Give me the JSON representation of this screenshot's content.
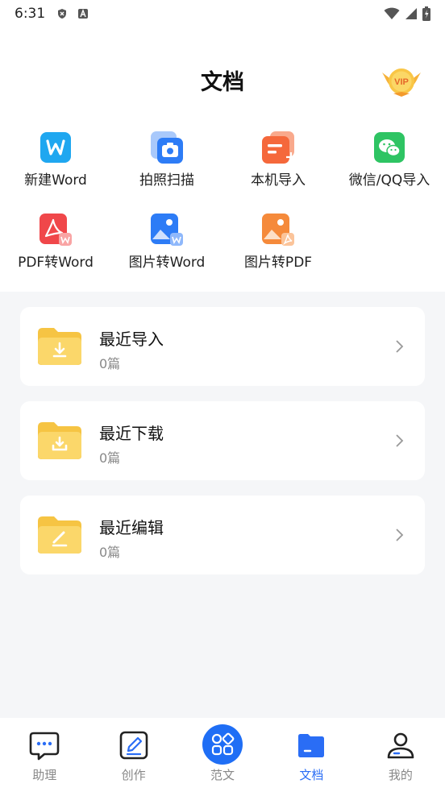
{
  "status_bar": {
    "time": "6:31"
  },
  "page": {
    "title": "文档"
  },
  "vip": {
    "label": "VIP"
  },
  "tools": [
    {
      "label": "新建Word",
      "icon": "word-icon",
      "color": "#1fa7f0"
    },
    {
      "label": "拍照扫描",
      "icon": "camera-scan-icon",
      "color": "#2d7cf6"
    },
    {
      "label": "本机导入",
      "icon": "local-import-icon",
      "color": "#f5683b"
    },
    {
      "label": "微信/QQ导入",
      "icon": "wechat-icon",
      "color": "#2ec463"
    },
    {
      "label": "PDF转Word",
      "icon": "pdf-to-word-icon",
      "color": "#f0474a"
    },
    {
      "label": "图片转Word",
      "icon": "image-to-word-icon",
      "color": "#2d7cf6"
    },
    {
      "label": "图片转PDF",
      "icon": "image-to-pdf-icon",
      "color": "#f58a3b"
    }
  ],
  "folders": [
    {
      "title": "最近导入",
      "count": "0篇",
      "icon": "folder-import-icon"
    },
    {
      "title": "最近下载",
      "count": "0篇",
      "icon": "folder-download-icon"
    },
    {
      "title": "最近编辑",
      "count": "0篇",
      "icon": "folder-edit-icon"
    }
  ],
  "nav": [
    {
      "label": "助理",
      "icon": "chat-bubble-icon",
      "active": false
    },
    {
      "label": "创作",
      "icon": "pen-edit-icon",
      "active": false
    },
    {
      "label": "范文",
      "icon": "grid-apps-icon",
      "active": false
    },
    {
      "label": "文档",
      "icon": "folder-icon",
      "active": true
    },
    {
      "label": "我的",
      "icon": "user-icon",
      "active": false
    }
  ],
  "colors": {
    "accent": "#2a6df5",
    "folder": "#f7cf5c",
    "background": "#f5f6f8"
  }
}
